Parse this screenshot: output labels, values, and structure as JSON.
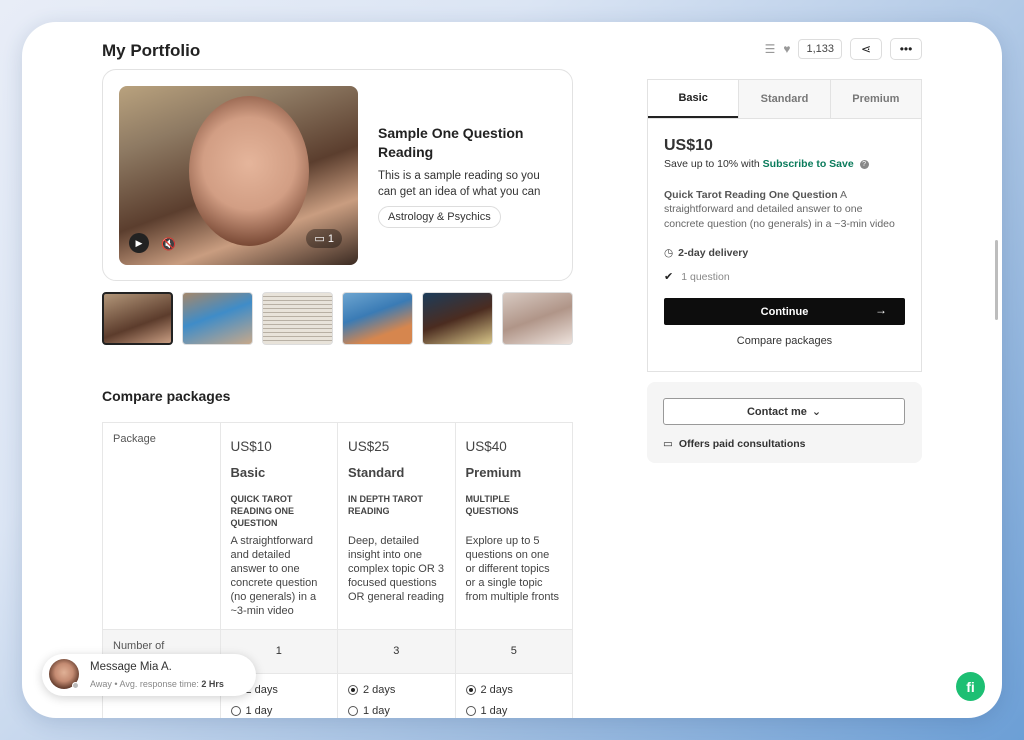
{
  "page": {
    "title": "My Portfolio"
  },
  "actions": {
    "likes": "1,133"
  },
  "gallery": {
    "sample_title": "Sample One Question Reading",
    "sample_desc": "This is a sample reading so you can get an idea of what you can",
    "tag": "Astrology & Psychics",
    "video_count": "1",
    "thumbnail_count": 6
  },
  "compare": {
    "section_title": "Compare packages",
    "package_label": "Package",
    "number_label": "Number of",
    "packages": [
      {
        "price": "US$10",
        "name": "Basic",
        "title": "QUICK TAROT READING ONE QUESTION",
        "desc": "A straightforward and detailed answer to one concrete question (no generals) in a ~3-min video",
        "number": "1"
      },
      {
        "price": "US$25",
        "name": "Standard",
        "title": "IN DEPTH TAROT READING",
        "desc": "Deep, detailed insight into one complex topic OR 3 focused questions OR general reading",
        "number": "3"
      },
      {
        "price": "US$40",
        "name": "Premium",
        "title": "MULTIPLE QUESTIONS",
        "desc": "Explore up to 5 questions on one or different topics or a single topic from multiple fronts",
        "number": "5"
      }
    ],
    "delivery_options": [
      "2 days",
      "1 day"
    ]
  },
  "package_panel": {
    "tabs": [
      "Basic",
      "Standard",
      "Premium"
    ],
    "price": "US$10",
    "save_text": "Save up to 10% with",
    "save_link": "Subscribe to Save",
    "help_icon": "?",
    "desc_title": "Quick Tarot Reading One Question",
    "desc_body": "A straightforward and detailed answer to one concrete question (no generals) in a ~3-min video",
    "delivery": "2-day delivery",
    "included": "1 question",
    "continue_label": "Continue",
    "compare_link": "Compare packages"
  },
  "contact": {
    "button_label": "Contact me",
    "consult_text": "Offers paid consultations"
  },
  "message": {
    "title": "Message Mia A.",
    "status": "Away",
    "response_label": "Avg. response time:",
    "response_time": "2 Hrs"
  },
  "logo": {
    "text": "fi"
  },
  "colors": {
    "accent_green": "#1dbf73",
    "link_green": "#0a7b5b",
    "button_black": "#0d0d0d"
  }
}
